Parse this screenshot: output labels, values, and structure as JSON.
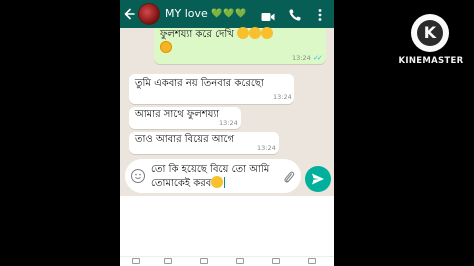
{
  "header": {
    "contact_name": "MY love",
    "name_emoji": "💚💚💚",
    "icons": [
      "back-arrow-icon",
      "contact-avatar",
      "video-call-icon",
      "phone-call-icon",
      "more-options-icon"
    ]
  },
  "messages": [
    {
      "direction": "outgoing",
      "text": "ফুলশয্যা করে দেখি",
      "emoji": [
        "smiling-face-with-hearts",
        "grinning-face",
        "smiling-face-with-hearts"
      ],
      "time": "13:24",
      "read": true
    },
    {
      "direction": "incoming",
      "text": "তুমি একবার নয় তিনবার করেছো",
      "time": "13:24"
    },
    {
      "direction": "incoming",
      "text": "আমার সাথে ফুলশয্যা",
      "time": "13:24"
    },
    {
      "direction": "incoming",
      "text": "তাও আবার বিয়ের আগে",
      "time": "13:24"
    }
  ],
  "composer": {
    "line1": "তো কি হয়েছে বিয়ে তো আমি",
    "line2": "তোমাকেই করব",
    "icons": [
      "emoji-icon",
      "attach-icon",
      "send-icon"
    ]
  },
  "watermark": {
    "brand": "KINEMASTER",
    "logo_letter": "K"
  },
  "colors": {
    "header_bg": "#075e54",
    "chat_bg": "#ece5dd",
    "outgoing_bubble": "#dcf8c6",
    "incoming_bubble": "#ffffff",
    "send_button": "#00af9c",
    "read_ticks": "#34b7f1"
  }
}
